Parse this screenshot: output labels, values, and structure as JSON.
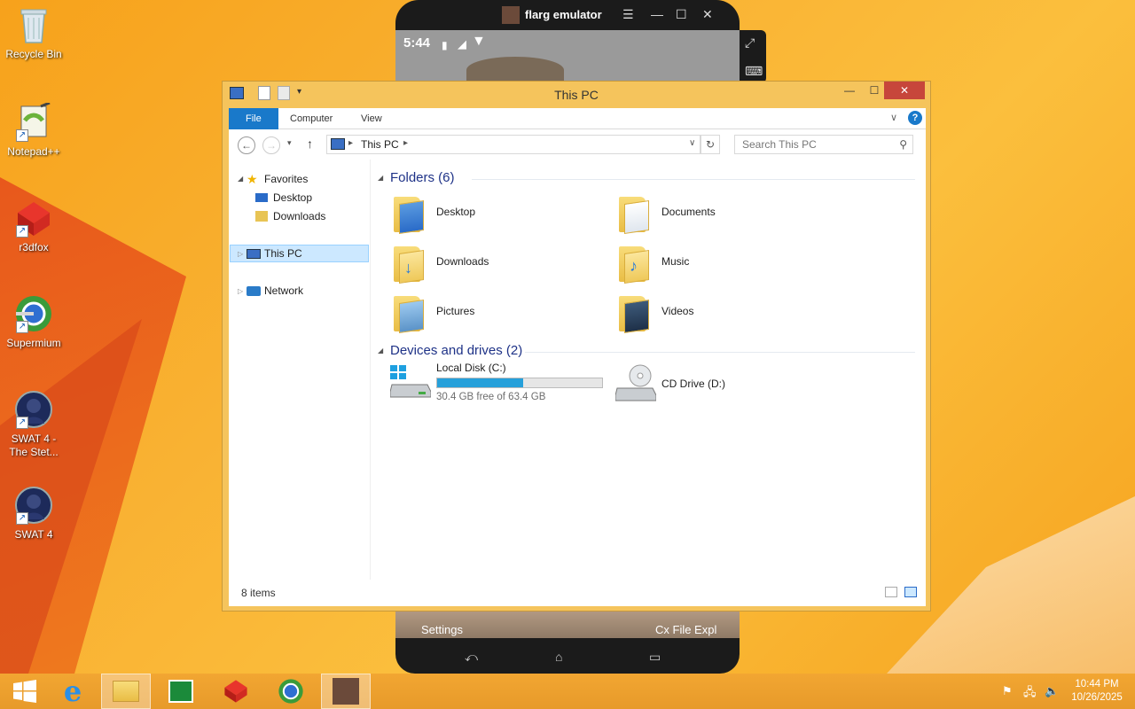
{
  "desktop_icons": [
    {
      "label": "Recycle Bin",
      "shortcut": false
    },
    {
      "label": "Notepad++",
      "shortcut": true
    },
    {
      "label": "r3dfox",
      "shortcut": true
    },
    {
      "label": "Supermium",
      "shortcut": true
    },
    {
      "label": "SWAT 4 - The Stet...",
      "shortcut": true
    },
    {
      "label": "SWAT 4",
      "shortcut": true
    }
  ],
  "emulator": {
    "title": "flarg emulator",
    "time": "5:44",
    "bottom_left": "Settings",
    "bottom_right": "Cx File Expl"
  },
  "explorer": {
    "title": "This PC",
    "ribbon_tabs": [
      "File",
      "Computer",
      "View"
    ],
    "address": "This PC",
    "search_placeholder": "Search This PC",
    "nav": {
      "favorites": "Favorites",
      "desktop": "Desktop",
      "downloads": "Downloads",
      "this_pc": "This PC",
      "network": "Network"
    },
    "folders_header": "Folders (6)",
    "folders": [
      "Desktop",
      "Documents",
      "Downloads",
      "Music",
      "Pictures",
      "Videos"
    ],
    "drives_header": "Devices and drives (2)",
    "drives": [
      {
        "name": "Local Disk (C:)",
        "free": "30.4 GB free of 63.4 GB",
        "used_fraction": 0.52
      },
      {
        "name": "CD Drive (D:)"
      }
    ],
    "status": "8 items"
  },
  "taskbar": {
    "time": "10:44 PM",
    "date": "10/26/2025"
  }
}
